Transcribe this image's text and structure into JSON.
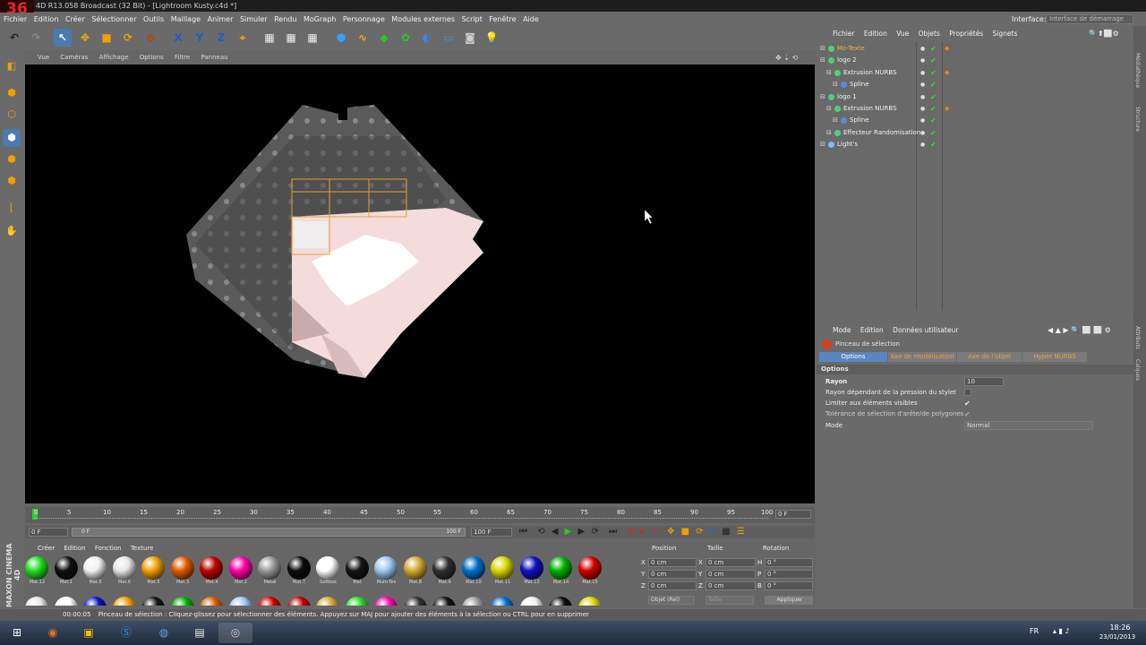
{
  "window": {
    "title": "4D R13.058 Broadcast (32 Bit) - [Lightroom Kusty.c4d *]",
    "logo_text": "36"
  },
  "menubar": {
    "items": [
      "Fichier",
      "Edition",
      "Créer",
      "Sélectionner",
      "Outils",
      "Maillage",
      "Animer",
      "Simuler",
      "Rendu",
      "MoGraph",
      "Personnage",
      "Modules externes",
      "Script",
      "Fenêtre",
      "Aide"
    ],
    "interface_label": "Interface:",
    "interface_value": "Interface de démarrage"
  },
  "viewport": {
    "menu": [
      "Vue",
      "Caméras",
      "Affichage",
      "Options",
      "Filtre",
      "Panneau"
    ],
    "background": "#000000"
  },
  "timeline": {
    "ticks": [
      "0",
      "5",
      "10",
      "15",
      "20",
      "25",
      "30",
      "35",
      "40",
      "45",
      "50",
      "55",
      "60",
      "65",
      "70",
      "75",
      "80",
      "85",
      "90",
      "95",
      "100"
    ],
    "current_frame": "0 F",
    "start_field": "0 F",
    "scrub_start": "0 F",
    "scrub_end": "100 F",
    "end_field": "100 F"
  },
  "materials": {
    "menu": [
      "Créer",
      "Edition",
      "Fonction",
      "Texture"
    ],
    "items": [
      {
        "label": "Mat.12",
        "color": "#22dd22"
      },
      {
        "label": "Mat.1",
        "color": "#111111"
      },
      {
        "label": "Mat.5",
        "color": "#f2f2f2"
      },
      {
        "label": "Mat.6",
        "color": "#e8e8e8"
      },
      {
        "label": "Mat.5",
        "color": "#f0a000"
      },
      {
        "label": "Mat.3",
        "color": "#e05a00"
      },
      {
        "label": "Mat.4",
        "color": "#c00000"
      },
      {
        "label": "Mat.2",
        "color": "#ff00aa"
      },
      {
        "label": "Métal",
        "color": "#9a9a9a"
      },
      {
        "label": "Mat.7",
        "color": "#0d0d0d"
      },
      {
        "label": "Softbox",
        "color": "#ffffff"
      },
      {
        "label": "Mat",
        "color": "#141414"
      },
      {
        "label": "Multi-Tex",
        "color": "#a0c8f0"
      },
      {
        "label": "Mat.8",
        "color": "#d4aa30"
      },
      {
        "label": "Mat.9",
        "color": "#303030"
      },
      {
        "label": "Mat.10",
        "color": "#0070d0"
      },
      {
        "label": "Mat.11",
        "color": "#d8d800"
      },
      {
        "label": "Mat.13",
        "color": "#1010c0"
      },
      {
        "label": "Mat.14",
        "color": "#00b000"
      },
      {
        "label": "Mat.15",
        "color": "#d00000"
      }
    ]
  },
  "coords": {
    "headers": [
      "Position",
      "Taille",
      "Rotation"
    ],
    "rows": [
      {
        "axis": "X",
        "pos": "0 cm",
        "saxis": "X",
        "size": "0 cm",
        "raxis": "H",
        "rot": "0 °"
      },
      {
        "axis": "Y",
        "pos": "0 cm",
        "saxis": "Y",
        "size": "0 cm",
        "raxis": "P",
        "rot": "0 °"
      },
      {
        "axis": "Z",
        "pos": "0 cm",
        "saxis": "Z",
        "size": "0 cm",
        "raxis": "B",
        "rot": "0 °"
      }
    ],
    "mode_select": "Objet (Rel)",
    "size_select": "Taille",
    "apply_label": "Appliquer"
  },
  "object_manager": {
    "menu": [
      "Fichier",
      "Edition",
      "Vue",
      "Objets",
      "Propriétés",
      "Signets"
    ],
    "objects": [
      {
        "name": "Mo-Texte",
        "indent": 0,
        "highlight": true
      },
      {
        "name": "logo 2",
        "indent": 0,
        "highlight": false
      },
      {
        "name": "Extrusion NURBS",
        "indent": 1,
        "highlight": false
      },
      {
        "name": "Spline",
        "indent": 2,
        "highlight": false
      },
      {
        "name": "logo 1",
        "indent": 0,
        "highlight": false
      },
      {
        "name": "Extrusion NURBS",
        "indent": 1,
        "highlight": false
      },
      {
        "name": "Spline",
        "indent": 2,
        "highlight": false
      },
      {
        "name": "Effecteur Randomisation",
        "indent": 1,
        "highlight": false
      },
      {
        "name": "Light's",
        "indent": 0,
        "highlight": false
      }
    ]
  },
  "attribute_manager": {
    "menu": [
      "Mode",
      "Edition",
      "Données utilisateur"
    ],
    "tool_name": "Pinceau de sélection",
    "tabs": [
      "Options",
      "Axe de modélisation",
      "Axe de l'objet",
      "Hyper NURBS"
    ],
    "section": "Options",
    "fields": [
      {
        "label": "Rayon",
        "value": "10"
      },
      {
        "label": "Rayon dépendant de la pression du stylet",
        "value": ""
      },
      {
        "label": "Limiter aux éléments visibles",
        "value": "✔"
      },
      {
        "label": "Tolérance de sélection d'arête/de polygones",
        "value": "✔"
      },
      {
        "label": "Mode",
        "value": "Normal"
      }
    ]
  },
  "side_tabs": [
    "Médiathèque",
    "Structure",
    "Attributs",
    "Calques"
  ],
  "statusbar": {
    "time": "00:00:05",
    "message": "Pinceau de sélection : Cliquez-glissez pour sélectionner des éléments. Appuyez sur MAJ pour ajouter des éléments à la sélection ou CTRL pour en supprimer"
  },
  "brand": "MAXON CINEMA 4D",
  "taskbar": {
    "lang": "FR",
    "time": "18:26",
    "date": "23/01/2013"
  }
}
